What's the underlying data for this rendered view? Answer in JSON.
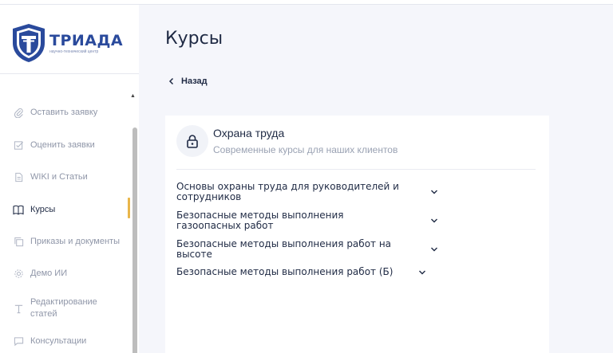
{
  "brand": {
    "name": "ТРИАДА",
    "tagline": "научно-технический центр",
    "accent": "#2a4a9c"
  },
  "sidebar": {
    "items": [
      {
        "label": "Оставить заявку",
        "icon": "paperclip-icon"
      },
      {
        "label": "Оценить заявки",
        "icon": "checkbox-edit-icon"
      },
      {
        "label": "WIKI и Статьи",
        "icon": "document-icon"
      },
      {
        "label": "Курсы",
        "icon": "open-book-icon",
        "active": true
      },
      {
        "label": "Приказы и документы",
        "icon": "copy-icon"
      },
      {
        "label": "Демо ИИ",
        "icon": "gear-icon"
      },
      {
        "label": "Редактирование статей",
        "icon": "text-icon"
      },
      {
        "label": "Консультации",
        "icon": "chat-icon"
      }
    ],
    "active_color": "#e9b64a"
  },
  "main": {
    "title": "Курсы",
    "back_label": "Назад"
  },
  "course": {
    "icon": "lock-icon",
    "title": "Охрана труда",
    "subtitle": "Современные курсы для наших клиентов",
    "modules": [
      {
        "line1": "Основы охраны труда для руководителей и",
        "line2": "сотрудников"
      },
      {
        "line1": "Безопасные методы выполнения",
        "line2": "газоопасных работ"
      },
      {
        "line1": "Безопасные методы выполнения работ на",
        "line2": "высоте"
      },
      {
        "line1": "Безопасные методы выполнения работ (Б)",
        "line2": ""
      }
    ]
  }
}
